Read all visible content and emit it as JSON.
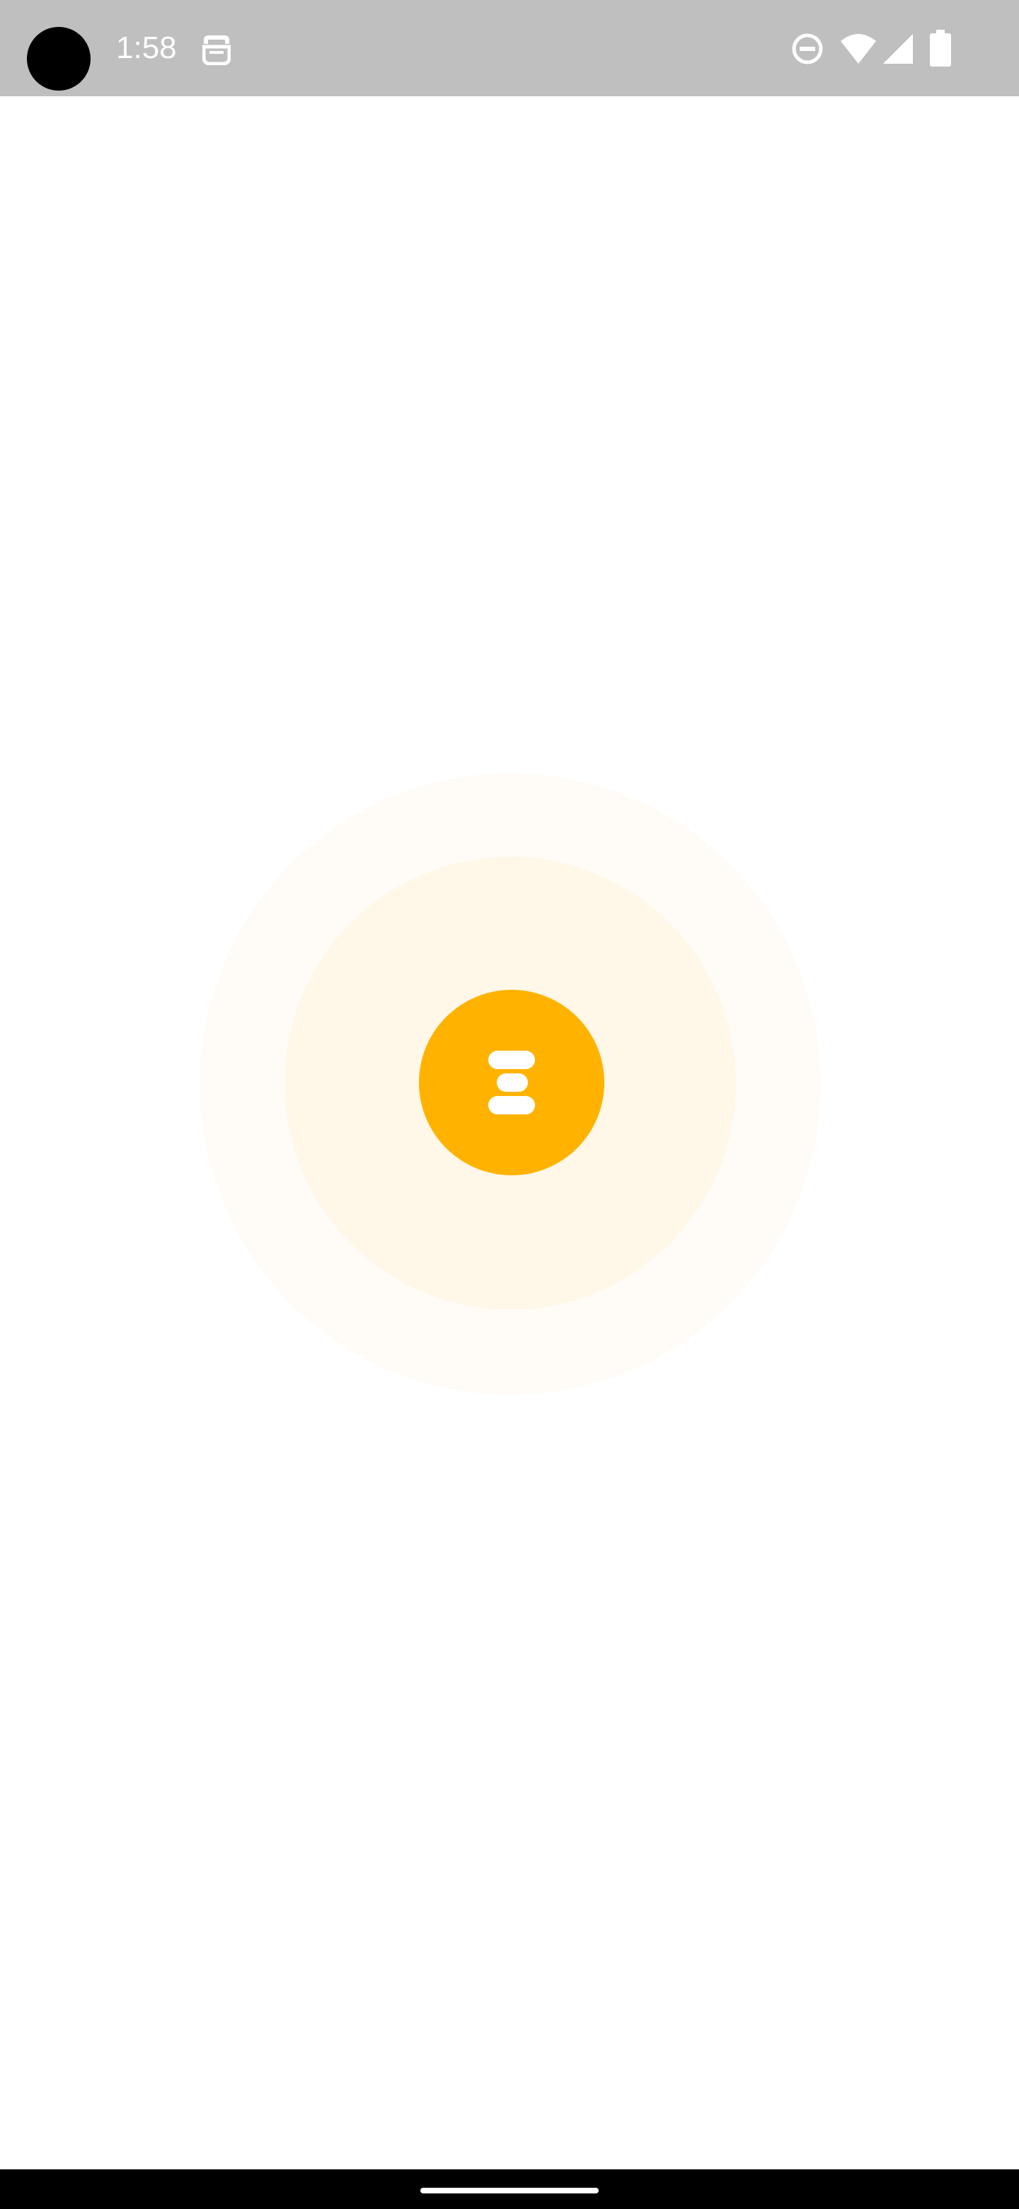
{
  "status_bar": {
    "time": "1:58",
    "icons": [
      "camera-cutout",
      "notification-icon",
      "do-not-disturb-icon",
      "wifi-icon",
      "signal-icon",
      "battery-icon"
    ]
  },
  "loader": {
    "logo_icon": "app-logo-icon",
    "colors": {
      "accent": "#ffb300",
      "inner_ring": "#fff7e8",
      "outer_ring": "#fffcf7"
    }
  },
  "navigation": {
    "home_indicator": "home-indicator"
  }
}
